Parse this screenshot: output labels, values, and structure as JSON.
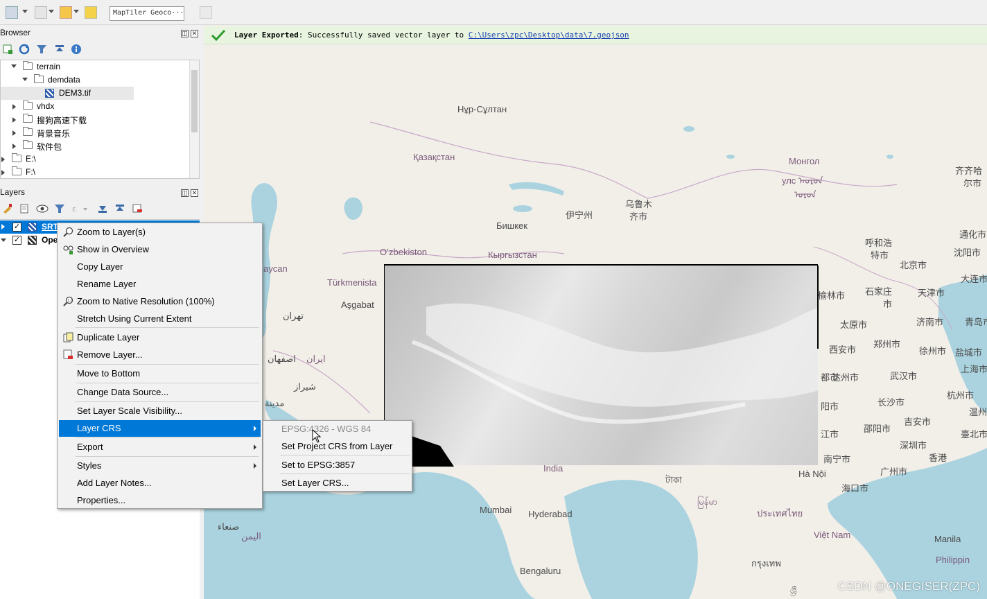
{
  "toolbar": {
    "geocoder_value": "MapTiler Geoco···"
  },
  "browser": {
    "title": "Browser",
    "items": [
      {
        "label": "terrain",
        "expanded": true,
        "type": "folder"
      },
      {
        "label": "demdata",
        "expanded": true,
        "type": "folder"
      },
      {
        "label": "DEM3.tif",
        "type": "raster"
      },
      {
        "label": "vhdx",
        "expanded": false,
        "type": "folder"
      },
      {
        "label": "搜狗高速下载",
        "expanded": false,
        "type": "folder"
      },
      {
        "label": "背景音乐",
        "expanded": false,
        "type": "folder"
      },
      {
        "label": "软件包",
        "expanded": false,
        "type": "folder"
      },
      {
        "label": "E:\\",
        "expanded": false,
        "type": "drive"
      },
      {
        "label": "F:\\",
        "expanded": false,
        "type": "drive"
      }
    ]
  },
  "layers": {
    "title": "Layers",
    "items": [
      {
        "label": "SRT",
        "checked": true,
        "selected": true
      },
      {
        "label": "Ope",
        "checked": true,
        "selected": false
      }
    ]
  },
  "notification": {
    "title": "Layer Exported",
    "message": ": Successfully saved vector layer to ",
    "path": "C:\\Users\\zpc\\Desktop\\data\\7.geojson"
  },
  "context_menu": {
    "items": [
      {
        "label": "Zoom to Layer(s)",
        "icon": "zoom-layer-icon"
      },
      {
        "label": "Show in Overview",
        "icon": "overview-icon"
      },
      {
        "label": "Copy Layer"
      },
      {
        "label": "Rename Layer"
      },
      {
        "label": "Zoom to Native Resolution (100%)",
        "icon": "native-res-icon"
      },
      {
        "label": "Stretch Using Current Extent"
      },
      {
        "label": "Duplicate Layer",
        "icon": "duplicate-icon"
      },
      {
        "label": "Remove Layer...",
        "icon": "remove-icon"
      },
      {
        "label": "Move to Bottom"
      },
      {
        "label": "Change Data Source..."
      },
      {
        "label": "Set Layer Scale Visibility..."
      },
      {
        "label": "Layer CRS",
        "submenu": true
      },
      {
        "label": "Export",
        "submenu": true
      },
      {
        "label": "Styles",
        "submenu": true
      },
      {
        "label": "Add Layer Notes..."
      },
      {
        "label": "Properties..."
      }
    ]
  },
  "crs_submenu": {
    "items": [
      {
        "label": "EPSG:4326 - WGS 84",
        "disabled": true
      },
      {
        "label": "Set Project CRS from Layer"
      },
      {
        "label": "Set to EPSG:3857"
      },
      {
        "label": "Set Layer CRS..."
      }
    ]
  },
  "map_labels": {
    "astana": "Нұр-Сұлтан",
    "kazakhstan": "Қазақстан",
    "mongolia": "Монгол",
    "mongolia2": "улс ᠠᠤᠷᠤᠨ",
    "mongolia3": "ᠤᠷᠤᠨ",
    "urumqi": "乌鲁木",
    "urumqi2": "齐市",
    "yining": "伊宁州",
    "bishkek": "Бишкек",
    "uzbekistan": "Oʼzbekiston",
    "kyrgyzstan": "Кыргызстан",
    "turkmenistan": "Türkmenista",
    "ashgabat": "Aşgabat",
    "tehran": "تهران",
    "iran": "ایران",
    "isfahan": "اصفهان",
    "shiraz": "شیراز",
    "medina": "مدينة",
    "yemen": "اليمن",
    "sanaa": "صنعاء",
    "azerbaijan": "aycan",
    "india": "India",
    "mumbai": "Mumbai",
    "hyderabad": "Hyderabad",
    "bengaluru": "Bengaluru",
    "hanoi": "Hà Nội",
    "vietnam": "Việt Nam",
    "manila": "Manila",
    "philippines": "Philippin",
    "beijing": "北京市",
    "tianjin": "天津市",
    "shijiazhuang": "石家庄",
    "shijiazhuang2": "市",
    "dalian": "大连市",
    "qingdao": "青岛市",
    "jinan": "济南市",
    "taiyuan": "太原市",
    "zhengzhou": "郑州市",
    "xian": "西安市",
    "xuzhou": "徐州市",
    "yancheng": "盐城市",
    "shanghai": "上海市",
    "wuhan": "武汉市",
    "dazhou": "达州市",
    "hangzhou": "杭州市",
    "changsha": "长沙市",
    "wenzhou": "温州市",
    "shaoyang": "邵阳市",
    "jian": "吉安市",
    "taipei": "臺北市",
    "guangzhou": "广州市",
    "shenzhen": "深圳市",
    "hongkong": "香港",
    "nanning": "南宁市",
    "haikou": "海口市",
    "hohhot": "呼和浩",
    "hohhot2": "特市",
    "shenyang": "沈阳市",
    "tonghua": "通化市",
    "qiqihar": "齐齐哈",
    "qiqihar2": "尔市",
    "yulin": "榆林市",
    "guiyang": "阳市",
    "kunming": "江市",
    "chengdu": "都市",
    "bangladesh": "টাকা",
    "myanmar": "မြန်မာ",
    "thailand": "ประเทศไทย",
    "cambodia": "กรุงเทพ",
    "srilanka": "ශ්‍රී"
  },
  "watermark": "CSDN @ONEGISER(ZPC)",
  "colors": {
    "selection": "#0078d7",
    "notification_bg": "#e8f4e0",
    "water": "#aad3df",
    "land": "#f2efe9"
  }
}
